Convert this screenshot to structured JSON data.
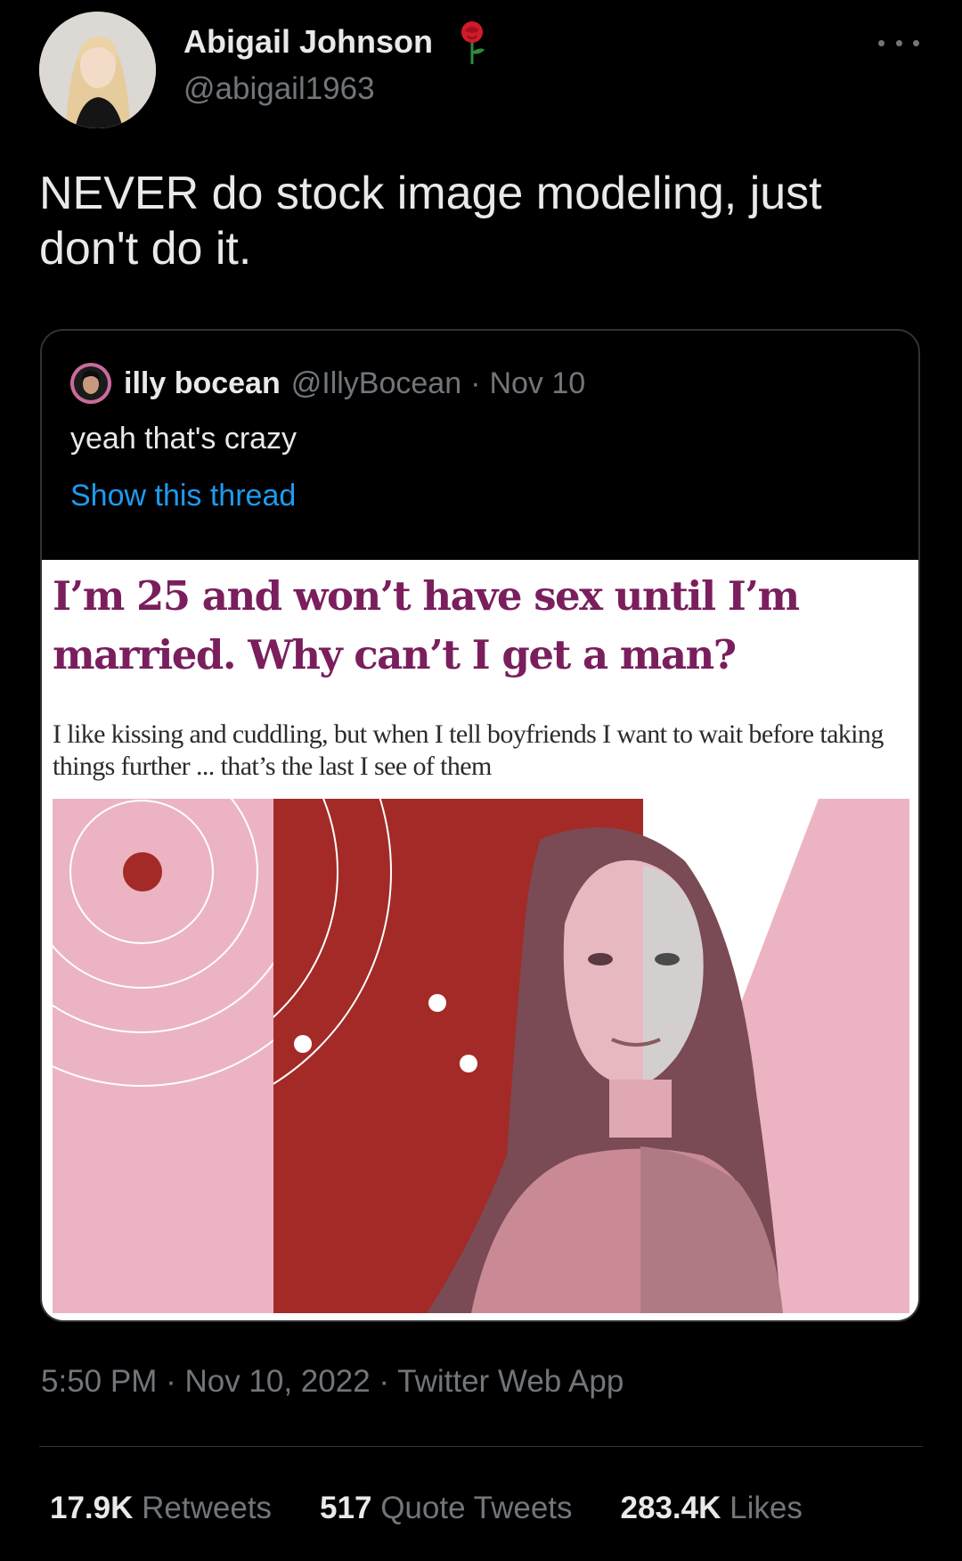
{
  "author": {
    "name": "Abigail Johnson",
    "handle": "@abigail1963",
    "badge_icon": "rose-icon"
  },
  "tweet": {
    "text": "NEVER do stock image modeling, just don't do it."
  },
  "quote": {
    "name": "illy bocean",
    "handle": "@IllyBocean",
    "separator": "·",
    "date": "Nov 10",
    "text": "yeah that's crazy",
    "show_thread": "Show this thread"
  },
  "article": {
    "headline": "I’m 25 and won’t have sex until I’m married. Why can’t I get a man?",
    "standfirst": "I like kissing and cuddling, but when I tell boyfriends I want to wait before taking things further ... that’s the last I see of them"
  },
  "meta": "5:50 PM · Nov 10, 2022 · Twitter Web App",
  "stats": {
    "retweets_count": "17.9K",
    "retweets_label": "Retweets",
    "quotes_count": "517",
    "quotes_label": "Quote Tweets",
    "likes_count": "283.4K",
    "likes_label": "Likes"
  },
  "colors": {
    "background": "#000000",
    "text_primary": "#e7e9ea",
    "text_secondary": "#71767b",
    "link": "#1d9bf0",
    "headline": "#7a1e5d",
    "art_pink": "#ecb4c2",
    "art_red": "#a32a26"
  }
}
